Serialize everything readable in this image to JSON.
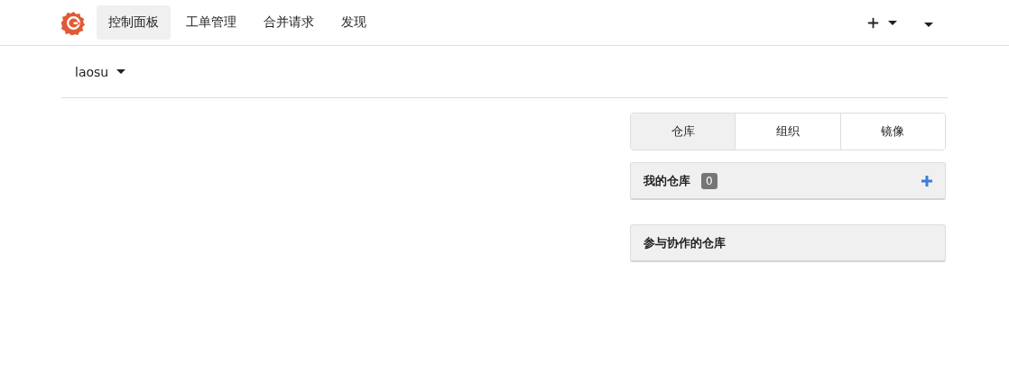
{
  "nav": {
    "items": [
      {
        "label": "控制面板",
        "selected": true
      },
      {
        "label": "工单管理",
        "selected": false
      },
      {
        "label": "合并请求",
        "selected": false
      },
      {
        "label": "发现",
        "selected": false
      }
    ]
  },
  "context": {
    "user": "laosu"
  },
  "tabs": [
    {
      "label": "仓库",
      "selected": true
    },
    {
      "label": "组织",
      "selected": false
    },
    {
      "label": "镜像",
      "selected": false
    }
  ],
  "panels": [
    {
      "kind": "owned",
      "title": "我的仓库",
      "count": "0"
    },
    {
      "kind": "collab",
      "title": "参与协作的仓库"
    }
  ]
}
